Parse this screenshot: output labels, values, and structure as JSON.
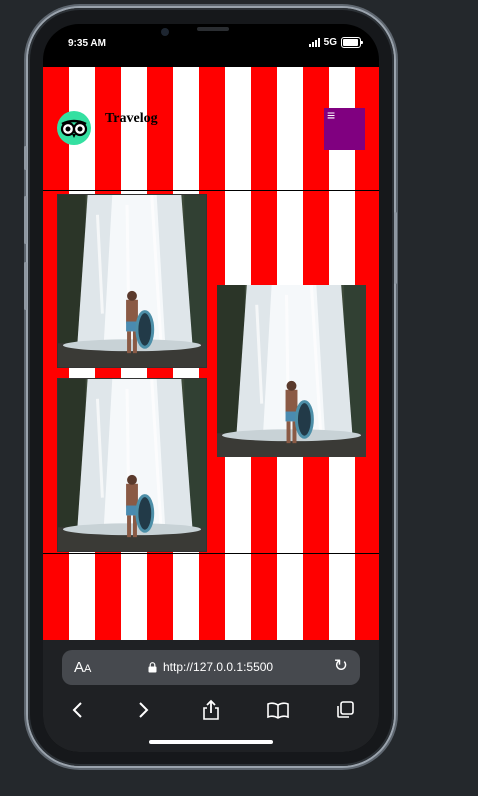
{
  "status_bar": {
    "time": "9:35 AM",
    "network": "5G"
  },
  "site": {
    "brand": "Travelog",
    "menu_icon": "hamburger-icon",
    "logo_icon": "owl-eyes-icon",
    "colors": {
      "stripe_red": "#ff0000",
      "stripe_white": "#ffffff",
      "menu_bg": "#800080",
      "logo_bg": "#34e0a1"
    },
    "gallery": [
      {
        "subject": "man-with-tube-at-waterfall"
      },
      {
        "subject": "man-with-tube-at-waterfall"
      },
      {
        "subject": "man-with-tube-at-waterfall"
      }
    ]
  },
  "browser": {
    "text_size_label": "AA",
    "url": "http://127.0.0.1:5500",
    "icons": [
      "back-icon",
      "forward-icon",
      "share-icon",
      "bookmarks-icon",
      "tabs-icon"
    ]
  }
}
